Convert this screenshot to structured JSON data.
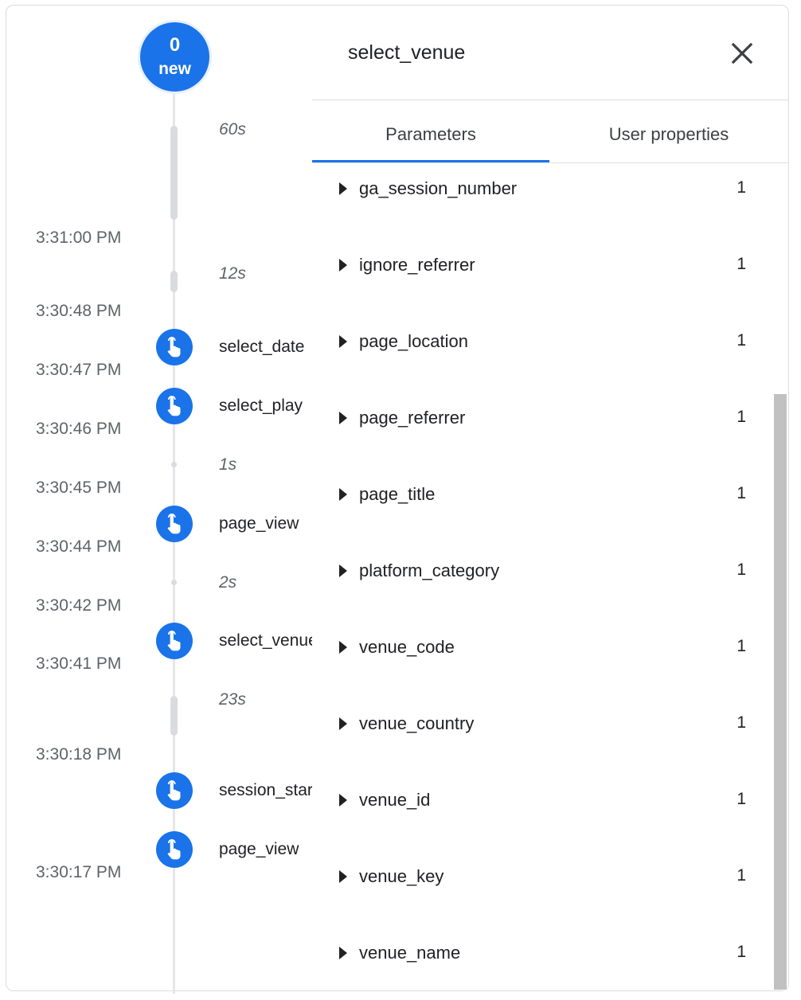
{
  "new_indicator": {
    "count": "0",
    "label": "new"
  },
  "timeline": {
    "times": [
      "3:31:00 PM",
      "3:30:48 PM",
      "3:30:47 PM",
      "3:30:46 PM",
      "3:30:45 PM",
      "3:30:44 PM",
      "3:30:42 PM",
      "3:30:41 PM",
      "3:30:18 PM",
      "3:30:17 PM"
    ],
    "durations": [
      "60s",
      "12s",
      "1s",
      "2s",
      "23s"
    ],
    "events": [
      "select_date",
      "select_play",
      "page_view",
      "select_venue",
      "session_start",
      "page_view"
    ],
    "event_icon": "touch-app-icon"
  },
  "panel": {
    "title": "select_venue",
    "close_icon": "close-icon",
    "tabs": [
      "Parameters",
      "User properties"
    ],
    "active_tab": "Parameters",
    "parameters": [
      {
        "name": "ga_session_number",
        "count": "1"
      },
      {
        "name": "ignore_referrer",
        "count": "1"
      },
      {
        "name": "page_location",
        "count": "1"
      },
      {
        "name": "page_referrer",
        "count": "1"
      },
      {
        "name": "page_title",
        "count": "1"
      },
      {
        "name": "platform_category",
        "count": "1"
      },
      {
        "name": "venue_code",
        "count": "1"
      },
      {
        "name": "venue_country",
        "count": "1"
      },
      {
        "name": "venue_id",
        "count": "1"
      },
      {
        "name": "venue_key",
        "count": "1"
      },
      {
        "name": "venue_name",
        "count": "1"
      }
    ]
  },
  "colors": {
    "accent": "#1a73e8",
    "text": "#202124",
    "muted": "#5f6368"
  }
}
